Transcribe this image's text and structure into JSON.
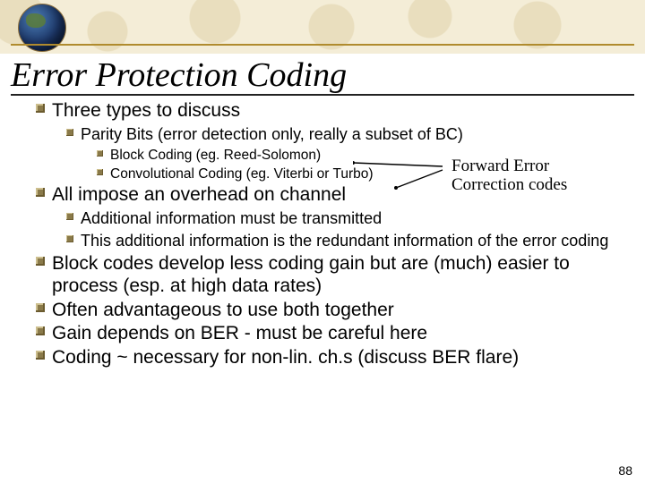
{
  "title": "Error Protection Coding",
  "annotation": "Forward Error Correction codes",
  "page_number": "88",
  "bullets": {
    "l1a": "Three types to discuss",
    "l2a": "Parity Bits (error detection only, really a subset of BC)",
    "l3a": "Block Coding (eg. Reed-Solomon)",
    "l3b": "Convolutional Coding (eg. Viterbi or Turbo)",
    "l1b": "All impose an overhead on channel",
    "l2b": "Additional information must be transmitted",
    "l2c": "This additional information is the redundant information of the error coding",
    "l1c": "Block codes develop less coding gain but are (much) easier to process (esp. at high data rates)",
    "l1d": "Often advantageous to use both together",
    "l1e": "Gain depends on BER - must be careful here",
    "l1f": "Coding ~ necessary for non-lin. ch.s (discuss BER flare)"
  }
}
